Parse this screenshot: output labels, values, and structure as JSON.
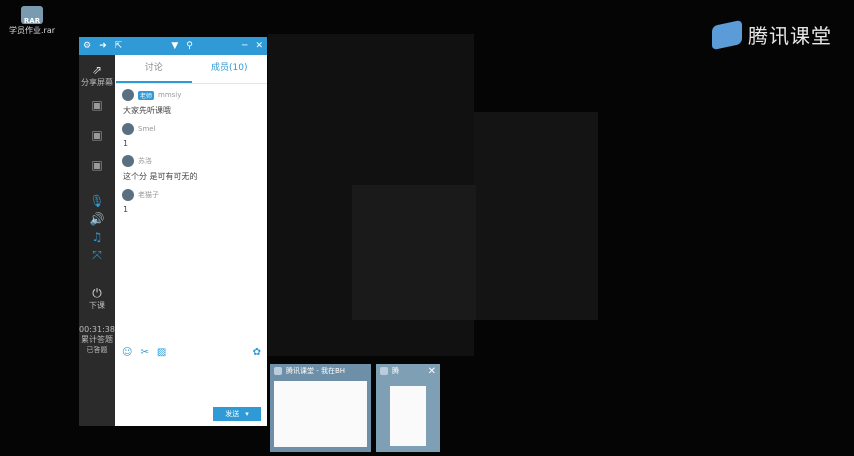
{
  "desktop": {
    "rar_icon_label": "学员作业.rar",
    "rar_badge": "RAR",
    "brand_name": "腾讯课堂"
  },
  "window": {
    "tabs": [
      "讨论",
      "成员(10)"
    ],
    "sidebar": {
      "share_screen": "分享屏幕",
      "end_class": "下课",
      "timer": "00:31:38",
      "stats": "累计答题",
      "stats2": "已答题"
    },
    "messages": [
      {
        "user": "mmsiy",
        "badge": "老师",
        "text": "大家先听课哦"
      },
      {
        "user": "Smel",
        "badge": "",
        "text": "1"
      },
      {
        "user": "苏洛",
        "badge": "",
        "text": "这个分 是可有可无的"
      },
      {
        "user": "老猫子",
        "badge": "",
        "text": "1"
      }
    ],
    "send_label": "发送",
    "send_dropdown": "▾"
  },
  "taskbar_thumbs": {
    "thumb1_title": "腾讯课堂 - 我在BH",
    "thumb2_title": "腾"
  },
  "colors": {
    "accent": "#2f9ad6",
    "sidebar": "#2b2b2b"
  }
}
